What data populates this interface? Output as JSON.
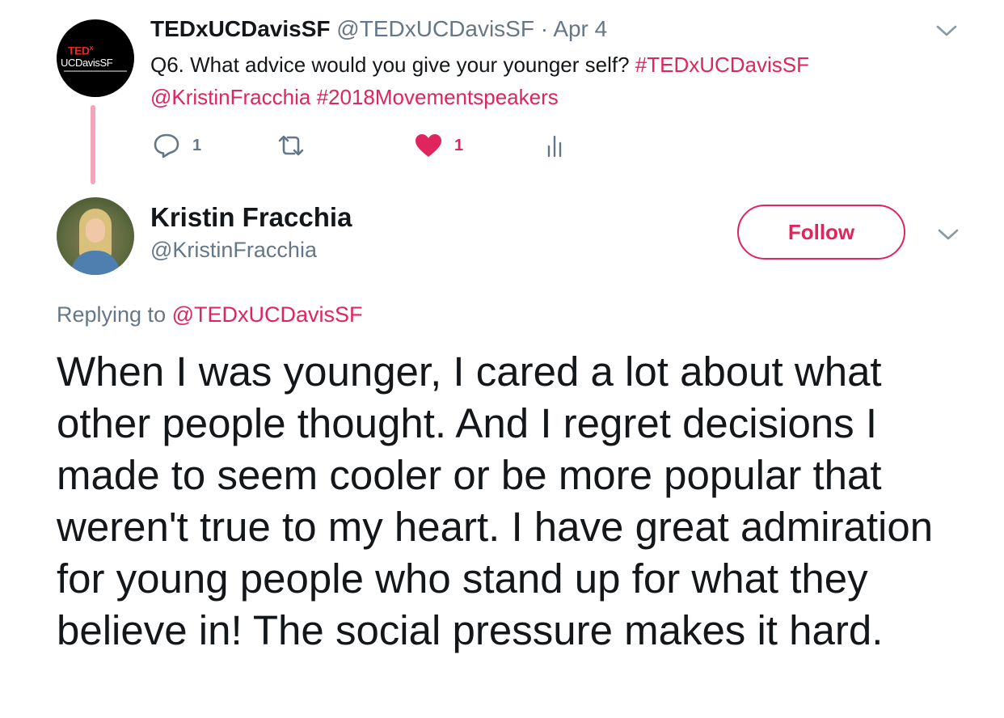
{
  "parent_tweet": {
    "avatar": {
      "brand": "TED",
      "brand_x": "x",
      "name": "UCDavisSF"
    },
    "author_name": "TEDxUCDavisSF",
    "author_handle": "@TEDxUCDavisSF",
    "separator": " · ",
    "date": "Apr 4",
    "text": "Q6. What advice would you give your younger self? ",
    "hashtag_1": "#TEDxUCDavisSF",
    "mention": "@KristinFracchia",
    "hashtag_2": "#2018Movementspeakers",
    "actions": {
      "reply_count": "1",
      "like_count": "1"
    }
  },
  "reply_tweet": {
    "author_name": "Kristin Fracchia",
    "author_handle": "@KristinFracchia",
    "follow_label": "Follow",
    "replying_prefix": "Replying to ",
    "replying_handle": "@TEDxUCDavisSF",
    "body": "When I was younger, I cared a lot about what other people thought. And I regret decisions I made to seem cooler or be more popular that weren't true to my heart. I have great admiration for young people who stand up for what they believe in! The social pressure makes it hard."
  },
  "icons": [
    "reply-icon",
    "retweet-icon",
    "heart-icon",
    "analytics-icon",
    "chevron-down-icon"
  ],
  "colors": {
    "accent": "#e0245e",
    "secondary_text": "#657786",
    "primary_text": "#14171a",
    "thread_line": "#f4a6b8"
  }
}
